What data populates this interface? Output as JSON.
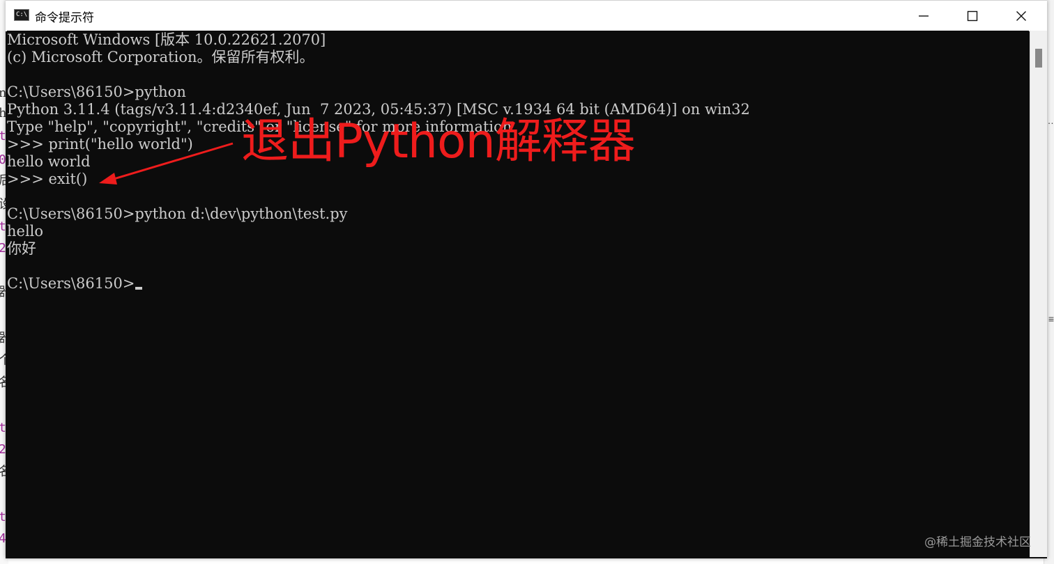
{
  "window": {
    "title": "命令提示符",
    "icon": "cmd-icon",
    "controls": [
      "minimize-icon",
      "maximize-icon",
      "close-icon"
    ]
  },
  "console": {
    "lines": [
      "Microsoft Windows [版本 10.0.22621.2070]",
      "(c) Microsoft Corporation。保留所有权利。",
      "",
      "C:\\Users\\86150>python",
      "Python 3.11.4 (tags/v3.11.4:d2340ef, Jun  7 2023, 05:45:37) [MSC v.1934 64 bit (AMD64)] on win32",
      "Type \"help\", \"copyright\", \"credits\" or \"license\" for more information.",
      ">>> print(\"hello world\")",
      "hello world",
      ">>> exit()",
      "",
      "C:\\Users\\86150>python d:\\dev\\python\\test.py",
      "hello",
      "你好",
      "",
      "C:\\Users\\86150>"
    ],
    "text_color": "#cccccc",
    "background_color": "#0c0c0c"
  },
  "annotation": {
    "text": "退出Python解释器",
    "color": "#ee1c1c"
  },
  "watermark": "@稀土掘金技术社区",
  "background_fragments": [
    "n",
    "h",
    "t",
    "0",
    "后",
    "设",
    "t",
    "2",
    "器",
    "器",
    "个",
    "名",
    "t",
    "2",
    "名",
    "t",
    "4"
  ]
}
